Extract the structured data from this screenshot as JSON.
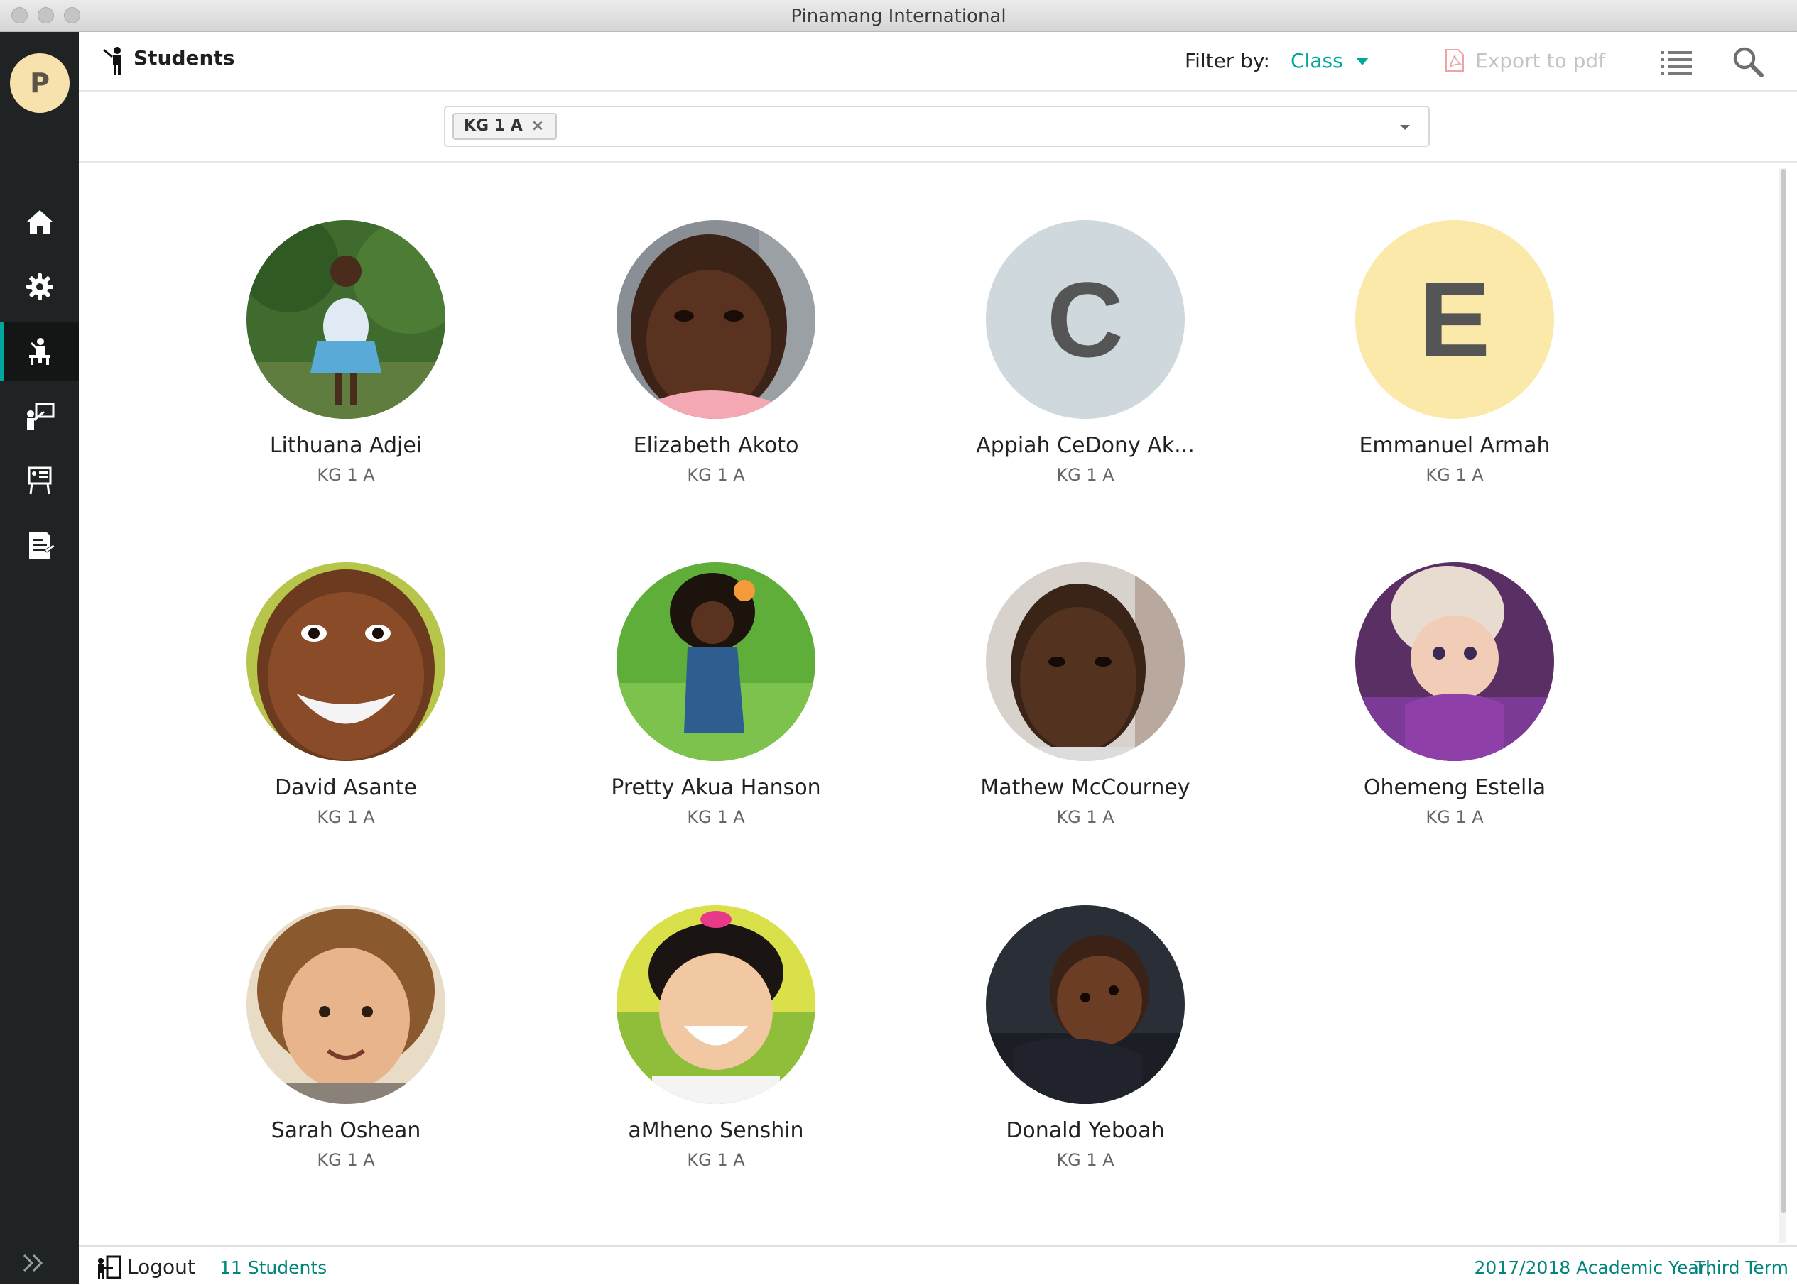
{
  "window": {
    "title": "Pinamang International"
  },
  "sidebar": {
    "brand_initial": "P",
    "items": [
      {
        "icon": "home-icon"
      },
      {
        "icon": "gear-icon"
      },
      {
        "icon": "students-icon",
        "active": true
      },
      {
        "icon": "teacher-board-icon"
      },
      {
        "icon": "classroom-board-icon"
      },
      {
        "icon": "report-icon"
      }
    ]
  },
  "header": {
    "title": "Students",
    "filter_label": "Filter by:",
    "filter_value": "Class",
    "export_label": "Export to pdf"
  },
  "class_filter": {
    "selected_tag": "KG 1 A",
    "remove_symbol": "×"
  },
  "students": [
    {
      "name": "Lithuana Adjei",
      "class": "KG 1 A",
      "avatar": "photo"
    },
    {
      "name": "Elizabeth Akoto",
      "class": "KG 1 A",
      "avatar": "photo"
    },
    {
      "name": "Appiah CeDony Ak...",
      "class": "KG 1 A",
      "avatar": "initial",
      "initial": "C",
      "color": "#cfd8dc"
    },
    {
      "name": "Emmanuel Armah",
      "class": "KG 1 A",
      "avatar": "initial",
      "initial": "E",
      "color": "#fbe9a9"
    },
    {
      "name": "David Asante",
      "class": "KG 1 A",
      "avatar": "photo"
    },
    {
      "name": "Pretty Akua Hanson",
      "class": "KG 1 A",
      "avatar": "photo"
    },
    {
      "name": "Mathew McCourney",
      "class": "KG 1 A",
      "avatar": "photo"
    },
    {
      "name": "Ohemeng Estella",
      "class": "KG 1 A",
      "avatar": "photo"
    },
    {
      "name": "Sarah Oshean",
      "class": "KG 1 A",
      "avatar": "photo"
    },
    {
      "name": "aMheno Senshin",
      "class": "KG 1 A",
      "avatar": "photo"
    },
    {
      "name": "Donald Yeboah",
      "class": "KG 1 A",
      "avatar": "photo"
    }
  ],
  "footer": {
    "logout_label": "Logout",
    "student_count": "11 Students",
    "academic_year": "2017/2018 Academic Year,",
    "term": "Third Term"
  },
  "colors": {
    "accent": "#00a79d",
    "sidebar": "#202323"
  }
}
